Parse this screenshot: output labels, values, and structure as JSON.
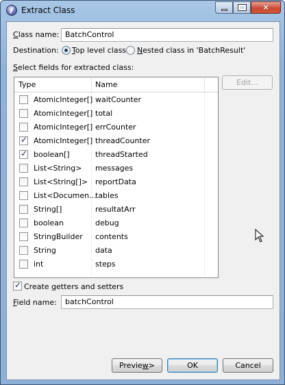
{
  "window": {
    "title": "Extract Class",
    "controls": {
      "minimize": "minimize",
      "maximize": "maximize",
      "close": "✕"
    }
  },
  "form": {
    "class_name_label_pre": "C",
    "class_name_label_post": "lass name:",
    "class_name_value": "BatchControl",
    "destination_label": "Destination:",
    "dest_top_pre": "",
    "dest_top_u": "T",
    "dest_top_post": "op level class",
    "dest_nested_pre": "",
    "dest_nested_u": "N",
    "dest_nested_post": "ested class in 'BatchResult'",
    "select_fields_u": "S",
    "select_fields_post": "elect fields for extracted class:",
    "edit_button": "Edit...",
    "getters_pre": "Create ",
    "getters_u": "g",
    "getters_post": "etters and setters",
    "field_name_u": "F",
    "field_name_post": "ield name:",
    "field_name_value": "batchControl"
  },
  "table": {
    "columns": [
      "Type",
      "Name"
    ],
    "rows": [
      {
        "type": "AtomicInteger[]",
        "name": "waitCounter",
        "checked": false
      },
      {
        "type": "AtomicInteger[]",
        "name": "total",
        "checked": false
      },
      {
        "type": "AtomicInteger[]",
        "name": "errCounter",
        "checked": false
      },
      {
        "type": "AtomicInteger[]",
        "name": "threadCounter",
        "checked": true
      },
      {
        "type": "boolean[]",
        "name": "threadStarted",
        "checked": true
      },
      {
        "type": "List<String>",
        "name": "messages",
        "checked": false
      },
      {
        "type": "List<String[]>",
        "name": "reportData",
        "checked": false
      },
      {
        "type": "List<Documen...",
        "name": "tables",
        "checked": false
      },
      {
        "type": "String[]",
        "name": "resultatArr",
        "checked": false
      },
      {
        "type": "boolean",
        "name": "debug",
        "checked": false
      },
      {
        "type": "StringBuilder",
        "name": "contents",
        "checked": false
      },
      {
        "type": "String",
        "name": "data",
        "checked": false
      },
      {
        "type": "int",
        "name": "steps",
        "checked": false
      }
    ]
  },
  "buttons": {
    "preview_pre": "Previe",
    "preview_u": "w",
    "preview_post": " >",
    "ok": "OK",
    "cancel": "Cancel"
  }
}
